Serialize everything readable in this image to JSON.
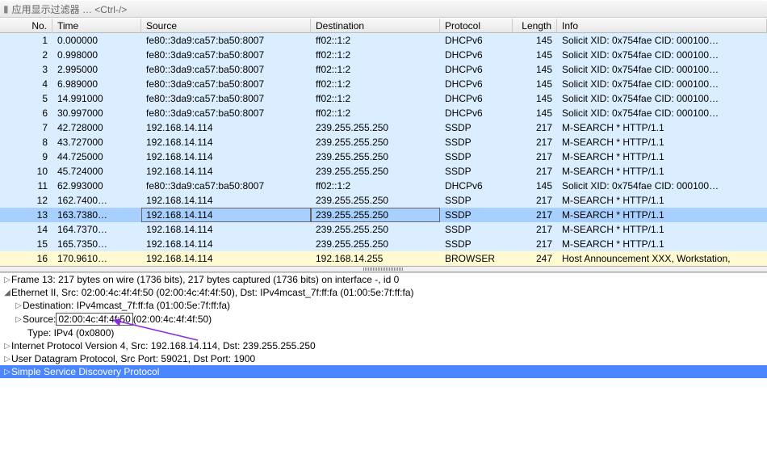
{
  "filter": {
    "hint": "应用显示过滤器 … <Ctrl-/>"
  },
  "columns": {
    "no": "No.",
    "time": "Time",
    "src": "Source",
    "dst": "Destination",
    "proto": "Protocol",
    "len": "Length",
    "info": "Info"
  },
  "packets": [
    {
      "no": "1",
      "time": "0.000000",
      "src": "fe80::3da9:ca57:ba50:8007",
      "dst": "ff02::1:2",
      "proto": "DHCPv6",
      "len": "145",
      "info": "Solicit XID: 0x754fae CID: 000100…",
      "cls": "cyan"
    },
    {
      "no": "2",
      "time": "0.998000",
      "src": "fe80::3da9:ca57:ba50:8007",
      "dst": "ff02::1:2",
      "proto": "DHCPv6",
      "len": "145",
      "info": "Solicit XID: 0x754fae CID: 000100…",
      "cls": "cyan"
    },
    {
      "no": "3",
      "time": "2.995000",
      "src": "fe80::3da9:ca57:ba50:8007",
      "dst": "ff02::1:2",
      "proto": "DHCPv6",
      "len": "145",
      "info": "Solicit XID: 0x754fae CID: 000100…",
      "cls": "cyan"
    },
    {
      "no": "4",
      "time": "6.989000",
      "src": "fe80::3da9:ca57:ba50:8007",
      "dst": "ff02::1:2",
      "proto": "DHCPv6",
      "len": "145",
      "info": "Solicit XID: 0x754fae CID: 000100…",
      "cls": "cyan"
    },
    {
      "no": "5",
      "time": "14.991000",
      "src": "fe80::3da9:ca57:ba50:8007",
      "dst": "ff02::1:2",
      "proto": "DHCPv6",
      "len": "145",
      "info": "Solicit XID: 0x754fae CID: 000100…",
      "cls": "cyan"
    },
    {
      "no": "6",
      "time": "30.997000",
      "src": "fe80::3da9:ca57:ba50:8007",
      "dst": "ff02::1:2",
      "proto": "DHCPv6",
      "len": "145",
      "info": "Solicit XID: 0x754fae CID: 000100…",
      "cls": "cyan"
    },
    {
      "no": "7",
      "time": "42.728000",
      "src": "192.168.14.114",
      "dst": "239.255.255.250",
      "proto": "SSDP",
      "len": "217",
      "info": "M-SEARCH * HTTP/1.1",
      "cls": "cyan"
    },
    {
      "no": "8",
      "time": "43.727000",
      "src": "192.168.14.114",
      "dst": "239.255.255.250",
      "proto": "SSDP",
      "len": "217",
      "info": "M-SEARCH * HTTP/1.1",
      "cls": "cyan"
    },
    {
      "no": "9",
      "time": "44.725000",
      "src": "192.168.14.114",
      "dst": "239.255.255.250",
      "proto": "SSDP",
      "len": "217",
      "info": "M-SEARCH * HTTP/1.1",
      "cls": "cyan"
    },
    {
      "no": "10",
      "time": "45.724000",
      "src": "192.168.14.114",
      "dst": "239.255.255.250",
      "proto": "SSDP",
      "len": "217",
      "info": "M-SEARCH * HTTP/1.1",
      "cls": "cyan"
    },
    {
      "no": "11",
      "time": "62.993000",
      "src": "fe80::3da9:ca57:ba50:8007",
      "dst": "ff02::1:2",
      "proto": "DHCPv6",
      "len": "145",
      "info": "Solicit XID: 0x754fae CID: 000100…",
      "cls": "cyan"
    },
    {
      "no": "12",
      "time": "162.7400…",
      "src": "192.168.14.114",
      "dst": "239.255.255.250",
      "proto": "SSDP",
      "len": "217",
      "info": "M-SEARCH * HTTP/1.1",
      "cls": "cyan"
    },
    {
      "no": "13",
      "time": "163.7380…",
      "src": "192.168.14.114",
      "dst": "239.255.255.250",
      "proto": "SSDP",
      "len": "217",
      "info": "M-SEARCH * HTTP/1.1",
      "cls": "sel"
    },
    {
      "no": "14",
      "time": "164.7370…",
      "src": "192.168.14.114",
      "dst": "239.255.255.250",
      "proto": "SSDP",
      "len": "217",
      "info": "M-SEARCH * HTTP/1.1",
      "cls": "cyan"
    },
    {
      "no": "15",
      "time": "165.7350…",
      "src": "192.168.14.114",
      "dst": "239.255.255.250",
      "proto": "SSDP",
      "len": "217",
      "info": "M-SEARCH * HTTP/1.1",
      "cls": "cyan"
    },
    {
      "no": "16",
      "time": "170.9610…",
      "src": "192.168.14.114",
      "dst": "192.168.14.255",
      "proto": "BROWSER",
      "len": "247",
      "info": "Host Announcement XXX, Workstation,",
      "cls": "yellow"
    }
  ],
  "details": {
    "frame": "Frame 13: 217 bytes on wire (1736 bits), 217 bytes captured (1736 bits) on interface -, id 0",
    "eth": "Ethernet II, Src: 02:00:4c:4f:4f:50 (02:00:4c:4f:4f:50), Dst: IPv4mcast_7f:ff:fa (01:00:5e:7f:ff:fa)",
    "eth_dst": "Destination: IPv4mcast_7f:ff:fa (01:00:5e:7f:ff:fa)",
    "eth_src_pre": "Source: ",
    "eth_src_mac": "02:00:4c:4f:4f:50",
    "eth_src_post": " (02:00:4c:4f:4f:50)",
    "eth_type": "Type: IPv4 (0x0800)",
    "ip": "Internet Protocol Version 4, Src: 192.168.14.114, Dst: 239.255.255.250",
    "udp": "User Datagram Protocol, Src Port: 59021, Dst Port: 1900",
    "ssdp": "Simple Service Discovery Protocol"
  }
}
